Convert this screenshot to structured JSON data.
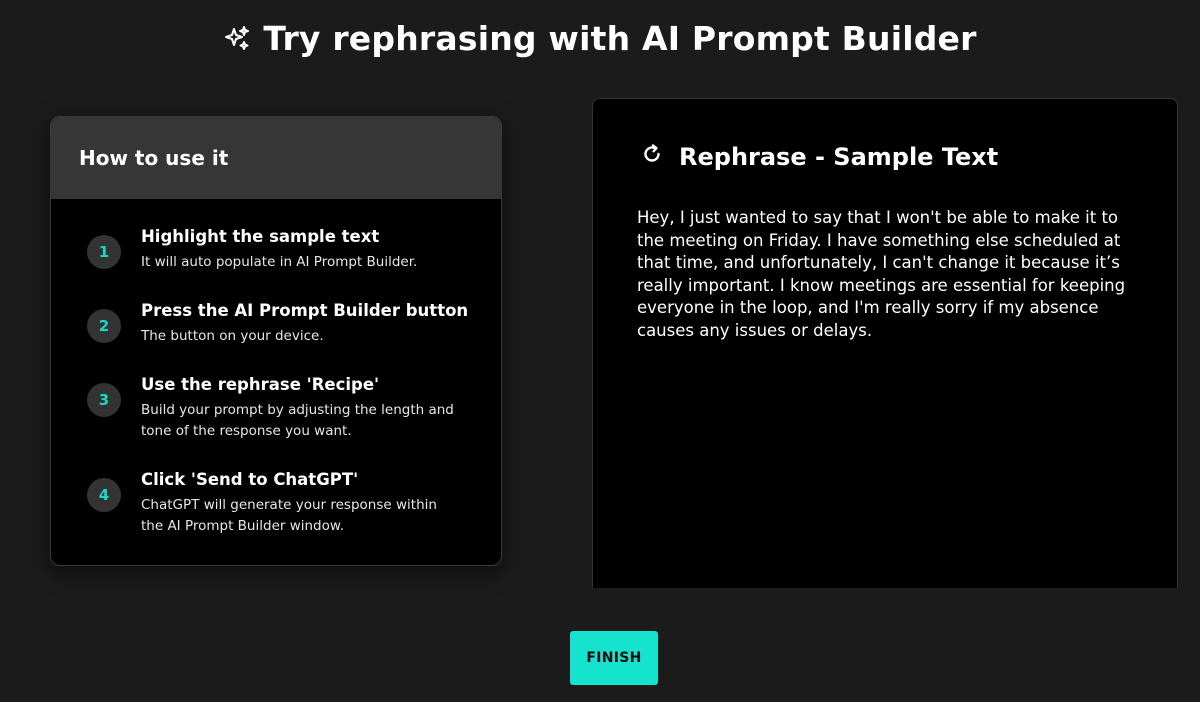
{
  "header": {
    "icon": "sparkles-icon",
    "title": "Try rephrasing with AI Prompt Builder"
  },
  "how_to": {
    "title": "How to use it",
    "steps": [
      {
        "number": "1",
        "title": "Highlight the sample text",
        "description": "It will auto populate in AI Prompt Builder."
      },
      {
        "number": "2",
        "title": "Press the AI Prompt Builder button",
        "description": "The button on your device."
      },
      {
        "number": "3",
        "title": "Use the rephrase 'Recipe'",
        "description": "Build your prompt by adjusting the length and tone of the response you want."
      },
      {
        "number": "4",
        "title": "Click 'Send to ChatGPT'",
        "description": "ChatGPT will generate your response within the AI Prompt Builder window."
      }
    ]
  },
  "sample": {
    "icon": "refresh-icon",
    "title": "Rephrase - Sample Text",
    "text": "Hey, I just wanted to say that I won't be able to make it to the meeting on Friday. I have something else scheduled at that time, and unfortunately, I can't change it because it’s really important. I know meetings are essential for keeping everyone in the loop, and I'm really sorry if my absence causes any issues or delays."
  },
  "footer": {
    "finish_label": "FINISH"
  },
  "colors": {
    "background": "#1b1b1c",
    "accent": "#16e3cd",
    "step_number": "#19d9c6",
    "card_header": "#363636"
  }
}
